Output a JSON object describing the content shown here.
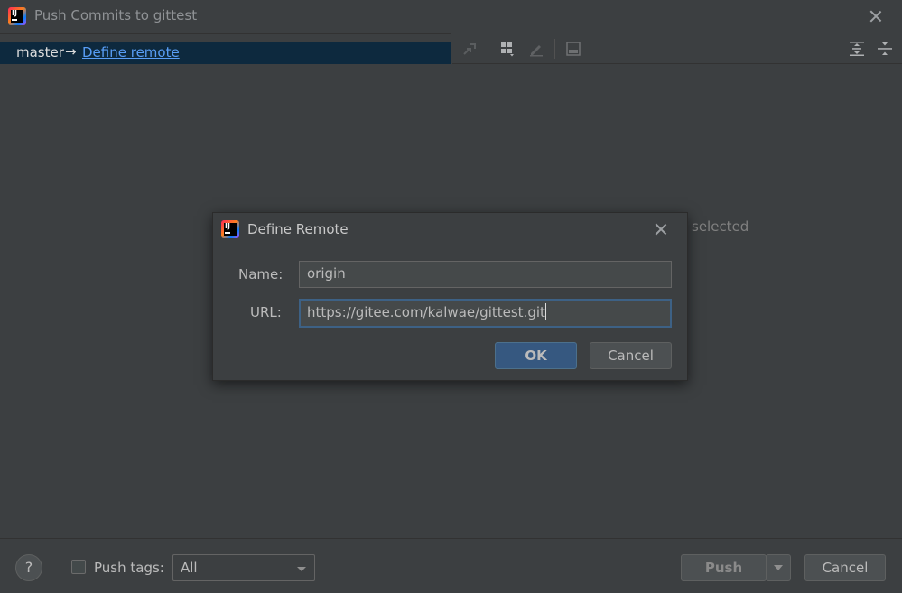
{
  "window": {
    "title": "Push Commits to gittest",
    "logo_text": "IJ"
  },
  "left_panel": {
    "branch": "master",
    "arrow": "→",
    "define_remote_link": "Define remote"
  },
  "right_panel": {
    "toolbar_icons": [
      "git-push-icon",
      "group-by-icon",
      "edit-icon",
      "preview-icon",
      "expand-all-icon",
      "collapse-all-icon"
    ],
    "status_text": "selected"
  },
  "bottom_bar": {
    "help_label": "?",
    "push_tags_label": "Push tags:",
    "push_tags_checked": false,
    "tags_select_value": "All",
    "push_label": "Push",
    "cancel_label": "Cancel"
  },
  "dialog": {
    "title": "Define Remote",
    "name_label": "Name:",
    "name_value": "origin",
    "url_label": "URL:",
    "url_value": "https://gitee.com/kalwae/gittest.git",
    "ok_label": "OK",
    "cancel_label": "Cancel"
  },
  "colors": {
    "background": "#3c3f41",
    "selection": "#0d293e",
    "link": "#589df6",
    "primary_button": "#365880",
    "focus_border": "#3d6185"
  }
}
